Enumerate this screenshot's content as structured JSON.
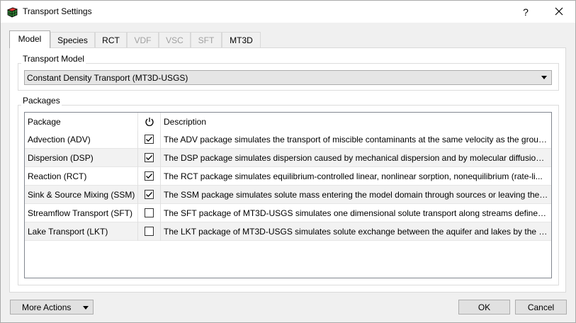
{
  "window": {
    "title": "Transport Settings",
    "help_label": "?",
    "close_label": "✕"
  },
  "tabs": [
    {
      "label": "Model",
      "active": true,
      "enabled": true
    },
    {
      "label": "Species",
      "active": false,
      "enabled": true
    },
    {
      "label": "RCT",
      "active": false,
      "enabled": true
    },
    {
      "label": "VDF",
      "active": false,
      "enabled": false
    },
    {
      "label": "VSC",
      "active": false,
      "enabled": false
    },
    {
      "label": "SFT",
      "active": false,
      "enabled": false
    },
    {
      "label": "MT3D",
      "active": false,
      "enabled": true
    }
  ],
  "transport_model": {
    "group_title": "Transport Model",
    "selected": "Constant Density Transport (MT3D-USGS)"
  },
  "packages": {
    "group_title": "Packages",
    "columns": {
      "package": "Package",
      "enabled_icon": "power-icon",
      "description": "Description"
    },
    "rows": [
      {
        "package": "Advection (ADV)",
        "checked": true,
        "description": "The ADV package simulates the transport of miscible contaminants at the same velocity as the groun..."
      },
      {
        "package": "Dispersion (DSP)",
        "checked": true,
        "description": "The DSP package simulates dispersion caused by mechanical dispersion and by molecular diffusion d..."
      },
      {
        "package": "Reaction (RCT)",
        "checked": true,
        "description": "The RCT package simulates equilibrium-controlled linear, nonlinear sorption, nonequilibrium (rate-li..."
      },
      {
        "package": "Sink & Source Mixing (SSM)",
        "checked": true,
        "description": "The SSM package simulates solute mass entering the model domain through sources or leaving the ..."
      },
      {
        "package": "Streamflow Transport (SFT)",
        "checked": false,
        "description": "The SFT package of MT3D-USGS simulates one dimensional solute transport along streams defined b..."
      },
      {
        "package": "Lake Transport (LKT)",
        "checked": false,
        "description": "The LKT package of MT3D-USGS simulates solute exchange between the aquifer and lakes by the LAK..."
      }
    ]
  },
  "footer": {
    "more_actions_label": "More Actions",
    "ok_label": "OK",
    "cancel_label": "Cancel"
  }
}
